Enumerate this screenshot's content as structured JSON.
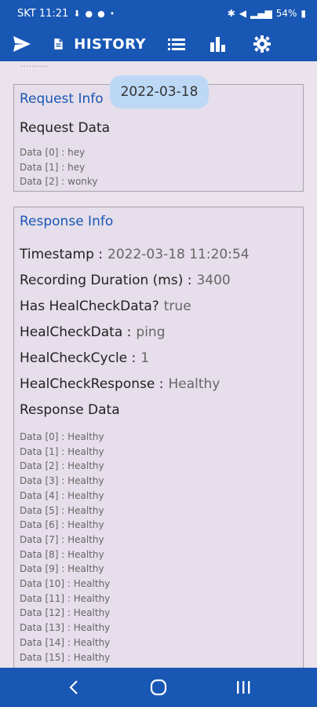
{
  "status_bar": {
    "carrier_time": "SKT 11:21",
    "icons_left": [
      "download-icon",
      "app-icon",
      "app-icon",
      "dot-icon"
    ],
    "battery": "54%"
  },
  "app_bar": {
    "title": "HISTORY",
    "icons": [
      "send-icon",
      "document-icon",
      "list-icon",
      "bar-chart-icon",
      "gear-icon"
    ],
    "color": "#1857b4"
  },
  "scroll_cut_text": "..........",
  "date_chip": "2022-03-18",
  "request_info": {
    "title": "Request Info",
    "data_label": "Request Data",
    "data": [
      "Data [0] : hey",
      "Data [1] : hey",
      "Data [2] : wonky"
    ]
  },
  "response_info": {
    "title": "Response Info",
    "fields": [
      {
        "label": "Timestamp :",
        "value": "2022-03-18 11:20:54"
      },
      {
        "label": "Recording Duration (ms) :",
        "value": "3400"
      },
      {
        "label": "Has HealCheckData?",
        "value": "true"
      },
      {
        "label": "HealCheckData :",
        "value": "ping"
      },
      {
        "label": "HealCheckCycle :",
        "value": "1"
      },
      {
        "label": "HealCheckResponse :",
        "value": "Healthy"
      }
    ],
    "data_label": "Response Data",
    "data": [
      "Data [0] : Healthy",
      "Data [1] : Healthy",
      "Data [2] : Healthy",
      "Data [3] : Healthy",
      "Data [4] : Healthy",
      "Data [5] : Healthy",
      "Data [6] : Healthy",
      "Data [7] : Healthy",
      "Data [8] : Healthy",
      "Data [9] : Healthy",
      "Data [10] : Healthy",
      "Data [11] : Healthy",
      "Data [12] : Healthy",
      "Data [13] : Healthy",
      "Data [14] : Healthy",
      "Data [15] : Healthy"
    ]
  },
  "nav_bar": {
    "buttons": [
      "back-icon",
      "home-icon",
      "recents-icon"
    ]
  }
}
